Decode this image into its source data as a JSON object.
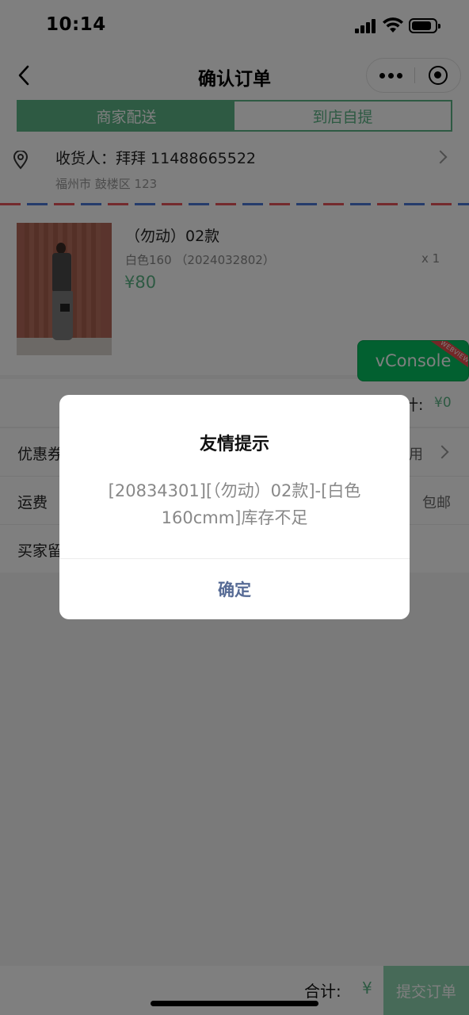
{
  "status_bar": {
    "time": "10:14"
  },
  "nav": {
    "title": "确认订单",
    "back_icon": "chevron-left-icon",
    "more_icon": "more-dots-icon",
    "close_icon": "target-close-icon"
  },
  "delivery_tabs": [
    {
      "label": "商家配送",
      "active": true
    },
    {
      "label": "到店自提",
      "active": false
    }
  ],
  "address": {
    "receiver": "收货人：拜拜 11488665522",
    "detail": "福州市 鼓楼区 123"
  },
  "product": {
    "name": "（勿动）02款",
    "spec": "白色160 （2024032802）",
    "quantity": "x 1",
    "price": "¥80"
  },
  "subtotal": {
    "label": "计:",
    "value": "¥0"
  },
  "rows": [
    {
      "label": "优惠券",
      "value": "可用"
    },
    {
      "label": "运费",
      "value": "包邮"
    },
    {
      "label": "买家留言",
      "value": ""
    }
  ],
  "vconsole": {
    "label": "vConsole",
    "ribbon": "WEBVIEW"
  },
  "bottom_bar": {
    "total_label": "合计:",
    "total_value": "¥",
    "submit_label": "提交订单"
  },
  "modal": {
    "title": "友情提示",
    "content": "[20834301][（勿动）02款]-[白色160cmm]库存不足",
    "confirm": "确定"
  },
  "colors": {
    "accent": "#5cb486",
    "link": "#576b95",
    "vconsole": "#05c160"
  }
}
